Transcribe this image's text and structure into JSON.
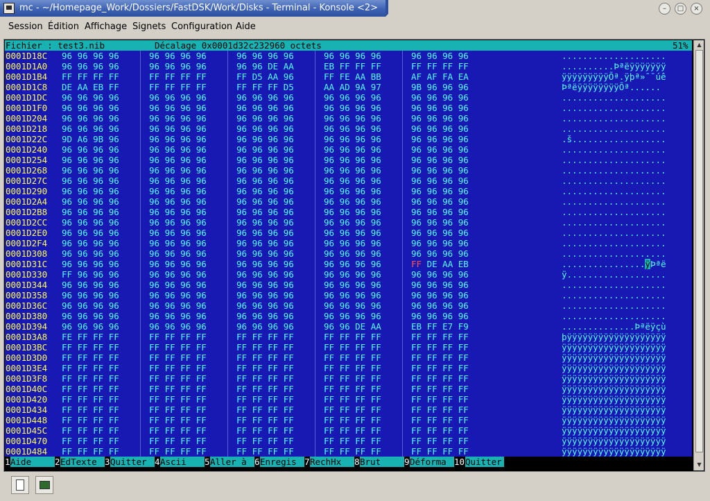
{
  "window": {
    "title": "mc - ~/Homepage_Work/Dossiers/FastDSK/Work/Disks - Terminal - Konsole <2>",
    "buttons": [
      "minimize",
      "maximize",
      "close"
    ]
  },
  "menu": [
    "Session",
    "Édition",
    "Affichage",
    "Signets",
    "Configuration",
    "Aide"
  ],
  "status": {
    "file_label": "Fichier : test3.nib",
    "offset_label": "Décalage 0x0001d32c232960 octets",
    "percent": "51%"
  },
  "rows": [
    {
      "addr": "0001D18C",
      "g": [
        "96 96 96 96",
        "96 96 96 96",
        "96 96 96 96",
        "96 96 96 96",
        "96 96 96 96"
      ],
      "ascii": "...................."
    },
    {
      "addr": "0001D1A0",
      "g": [
        "96 96 96 96",
        "96 96 96 96",
        "96 96 DE AA",
        "EB FF FF FF",
        "FF FF FF FF"
      ],
      "ascii": "..........Þªëÿÿÿÿÿÿÿ"
    },
    {
      "addr": "0001D1B4",
      "g": [
        "FF FF FF FF",
        "FF FF FF FF",
        "FF D5 AA 96",
        "FF FE AA BB",
        "AF AF FA EA"
      ],
      "ascii": "ÿÿÿÿÿÿÿÿÿÕª.ÿþª»¯¯úê"
    },
    {
      "addr": "0001D1C8",
      "g": [
        "DE AA EB FF",
        "FF FF FF FF",
        "FF FF FF D5",
        "AA AD 9A 97",
        "9B 96 96 96"
      ],
      "ascii": "ÞªëÿÿÿÿÿÿÿÿÕª­......"
    },
    {
      "addr": "0001D1DC",
      "g": [
        "96 96 96 96",
        "96 96 96 96",
        "96 96 96 96",
        "96 96 96 96",
        "96 96 96 96"
      ],
      "ascii": "...................."
    },
    {
      "addr": "0001D1F0",
      "g": [
        "96 96 96 96",
        "96 96 96 96",
        "96 96 96 96",
        "96 96 96 96",
        "96 96 96 96"
      ],
      "ascii": "...................."
    },
    {
      "addr": "0001D204",
      "g": [
        "96 96 96 96",
        "96 96 96 96",
        "96 96 96 96",
        "96 96 96 96",
        "96 96 96 96"
      ],
      "ascii": "...................."
    },
    {
      "addr": "0001D218",
      "g": [
        "96 96 96 96",
        "96 96 96 96",
        "96 96 96 96",
        "96 96 96 96",
        "96 96 96 96"
      ],
      "ascii": "...................."
    },
    {
      "addr": "0001D22C",
      "g": [
        "9D A6 9B 96",
        "96 96 96 96",
        "96 96 96 96",
        "96 96 96 96",
        "96 96 96 96"
      ],
      "ascii": ".š.................."
    },
    {
      "addr": "0001D240",
      "g": [
        "96 96 96 96",
        "96 96 96 96",
        "96 96 96 96",
        "96 96 96 96",
        "96 96 96 96"
      ],
      "ascii": "...................."
    },
    {
      "addr": "0001D254",
      "g": [
        "96 96 96 96",
        "96 96 96 96",
        "96 96 96 96",
        "96 96 96 96",
        "96 96 96 96"
      ],
      "ascii": "...................."
    },
    {
      "addr": "0001D268",
      "g": [
        "96 96 96 96",
        "96 96 96 96",
        "96 96 96 96",
        "96 96 96 96",
        "96 96 96 96"
      ],
      "ascii": "...................."
    },
    {
      "addr": "0001D27C",
      "g": [
        "96 96 96 96",
        "96 96 96 96",
        "96 96 96 96",
        "96 96 96 96",
        "96 96 96 96"
      ],
      "ascii": "...................."
    },
    {
      "addr": "0001D290",
      "g": [
        "96 96 96 96",
        "96 96 96 96",
        "96 96 96 96",
        "96 96 96 96",
        "96 96 96 96"
      ],
      "ascii": "...................."
    },
    {
      "addr": "0001D2A4",
      "g": [
        "96 96 96 96",
        "96 96 96 96",
        "96 96 96 96",
        "96 96 96 96",
        "96 96 96 96"
      ],
      "ascii": "...................."
    },
    {
      "addr": "0001D2B8",
      "g": [
        "96 96 96 96",
        "96 96 96 96",
        "96 96 96 96",
        "96 96 96 96",
        "96 96 96 96"
      ],
      "ascii": "...................."
    },
    {
      "addr": "0001D2CC",
      "g": [
        "96 96 96 96",
        "96 96 96 96",
        "96 96 96 96",
        "96 96 96 96",
        "96 96 96 96"
      ],
      "ascii": "...................."
    },
    {
      "addr": "0001D2E0",
      "g": [
        "96 96 96 96",
        "96 96 96 96",
        "96 96 96 96",
        "96 96 96 96",
        "96 96 96 96"
      ],
      "ascii": "...................."
    },
    {
      "addr": "0001D2F4",
      "g": [
        "96 96 96 96",
        "96 96 96 96",
        "96 96 96 96",
        "96 96 96 96",
        "96 96 96 96"
      ],
      "ascii": "...................."
    },
    {
      "addr": "0001D308",
      "g": [
        "96 96 96 96",
        "96 96 96 96",
        "96 96 96 96",
        "96 96 96 96",
        "96 96 96 96"
      ],
      "ascii": "...................."
    },
    {
      "addr": "0001D31C",
      "g": [
        "96 96 96 96",
        "96 96 96 96",
        "96 96 96 96",
        "96 96 96 96",
        "FF DE AA EB"
      ],
      "ascii": "................ÿÞªë",
      "cursor_hex": "FF",
      "cursor_ascii": "ÿ"
    },
    {
      "addr": "0001D330",
      "g": [
        "FF 96 96 96",
        "96 96 96 96",
        "96 96 96 96",
        "96 96 96 96",
        "96 96 96 96"
      ],
      "ascii": "ÿ..................."
    },
    {
      "addr": "0001D344",
      "g": [
        "96 96 96 96",
        "96 96 96 96",
        "96 96 96 96",
        "96 96 96 96",
        "96 96 96 96"
      ],
      "ascii": "...................."
    },
    {
      "addr": "0001D358",
      "g": [
        "96 96 96 96",
        "96 96 96 96",
        "96 96 96 96",
        "96 96 96 96",
        "96 96 96 96"
      ],
      "ascii": "...................."
    },
    {
      "addr": "0001D36C",
      "g": [
        "96 96 96 96",
        "96 96 96 96",
        "96 96 96 96",
        "96 96 96 96",
        "96 96 96 96"
      ],
      "ascii": "...................."
    },
    {
      "addr": "0001D380",
      "g": [
        "96 96 96 96",
        "96 96 96 96",
        "96 96 96 96",
        "96 96 96 96",
        "96 96 96 96"
      ],
      "ascii": "...................."
    },
    {
      "addr": "0001D394",
      "g": [
        "96 96 96 96",
        "96 96 96 96",
        "96 96 96 96",
        "96 96 DE AA",
        "EB FF E7 F9"
      ],
      "ascii": "..............Þªëÿçù"
    },
    {
      "addr": "0001D3A8",
      "g": [
        "FE FF FF FF",
        "FF FF FF FF",
        "FF FF FF FF",
        "FF FF FF FF",
        "FF FF FF FF"
      ],
      "ascii": "þÿÿÿÿÿÿÿÿÿÿÿÿÿÿÿÿÿÿÿ"
    },
    {
      "addr": "0001D3BC",
      "g": [
        "FF FF FF FF",
        "FF FF FF FF",
        "FF FF FF FF",
        "FF FF FF FF",
        "FF FF FF FF"
      ],
      "ascii": "ÿÿÿÿÿÿÿÿÿÿÿÿÿÿÿÿÿÿÿÿ"
    },
    {
      "addr": "0001D3D0",
      "g": [
        "FF FF FF FF",
        "FF FF FF FF",
        "FF FF FF FF",
        "FF FF FF FF",
        "FF FF FF FF"
      ],
      "ascii": "ÿÿÿÿÿÿÿÿÿÿÿÿÿÿÿÿÿÿÿÿ"
    },
    {
      "addr": "0001D3E4",
      "g": [
        "FF FF FF FF",
        "FF FF FF FF",
        "FF FF FF FF",
        "FF FF FF FF",
        "FF FF FF FF"
      ],
      "ascii": "ÿÿÿÿÿÿÿÿÿÿÿÿÿÿÿÿÿÿÿÿ"
    },
    {
      "addr": "0001D3F8",
      "g": [
        "FF FF FF FF",
        "FF FF FF FF",
        "FF FF FF FF",
        "FF FF FF FF",
        "FF FF FF FF"
      ],
      "ascii": "ÿÿÿÿÿÿÿÿÿÿÿÿÿÿÿÿÿÿÿÿ"
    },
    {
      "addr": "0001D40C",
      "g": [
        "FF FF FF FF",
        "FF FF FF FF",
        "FF FF FF FF",
        "FF FF FF FF",
        "FF FF FF FF"
      ],
      "ascii": "ÿÿÿÿÿÿÿÿÿÿÿÿÿÿÿÿÿÿÿÿ"
    },
    {
      "addr": "0001D420",
      "g": [
        "FF FF FF FF",
        "FF FF FF FF",
        "FF FF FF FF",
        "FF FF FF FF",
        "FF FF FF FF"
      ],
      "ascii": "ÿÿÿÿÿÿÿÿÿÿÿÿÿÿÿÿÿÿÿÿ"
    },
    {
      "addr": "0001D434",
      "g": [
        "FF FF FF FF",
        "FF FF FF FF",
        "FF FF FF FF",
        "FF FF FF FF",
        "FF FF FF FF"
      ],
      "ascii": "ÿÿÿÿÿÿÿÿÿÿÿÿÿÿÿÿÿÿÿÿ"
    },
    {
      "addr": "0001D448",
      "g": [
        "FF FF FF FF",
        "FF FF FF FF",
        "FF FF FF FF",
        "FF FF FF FF",
        "FF FF FF FF"
      ],
      "ascii": "ÿÿÿÿÿÿÿÿÿÿÿÿÿÿÿÿÿÿÿÿ"
    },
    {
      "addr": "0001D45C",
      "g": [
        "FF FF FF FF",
        "FF FF FF FF",
        "FF FF FF FF",
        "FF FF FF FF",
        "FF FF FF FF"
      ],
      "ascii": "ÿÿÿÿÿÿÿÿÿÿÿÿÿÿÿÿÿÿÿÿ"
    },
    {
      "addr": "0001D470",
      "g": [
        "FF FF FF FF",
        "FF FF FF FF",
        "FF FF FF FF",
        "FF FF FF FF",
        "FF FF FF FF"
      ],
      "ascii": "ÿÿÿÿÿÿÿÿÿÿÿÿÿÿÿÿÿÿÿÿ"
    },
    {
      "addr": "0001D484",
      "g": [
        "FF FF FF FF",
        "FF FF FF FF",
        "FF FF FF FF",
        "FF FF FF FF",
        "FF FF FF FF"
      ],
      "ascii": "ÿÿÿÿÿÿÿÿÿÿÿÿÿÿÿÿÿÿÿÿ"
    }
  ],
  "fkeys": [
    {
      "num": "1",
      "label": "Aide"
    },
    {
      "num": "2",
      "label": "EdTexte"
    },
    {
      "num": "3",
      "label": "Quitter"
    },
    {
      "num": "4",
      "label": "Ascii"
    },
    {
      "num": "5",
      "label": "Aller à"
    },
    {
      "num": "6",
      "label": "Enregis"
    },
    {
      "num": "7",
      "label": "RechHx"
    },
    {
      "num": "8",
      "label": "Brut"
    },
    {
      "num": "9",
      "label": "Déforma"
    },
    {
      "num": "10",
      "label": "Quitter"
    }
  ],
  "toolbar": {
    "icons": [
      "new-session-icon",
      "terminal-session-icon"
    ]
  },
  "colors": {
    "terminal_bg": "#1818b2",
    "address": "#ffff55",
    "hex": "#55ffff",
    "statusline": "#18b2b2",
    "highlight": "#ff5555"
  }
}
